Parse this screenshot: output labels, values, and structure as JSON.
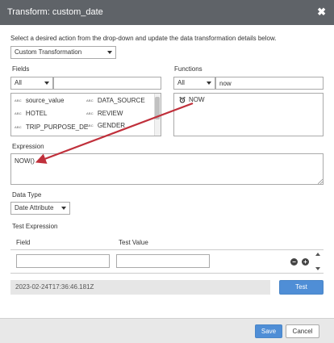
{
  "dialog": {
    "title": "Transform: custom_date",
    "close_glyph": "✖"
  },
  "instruction": "Select a desired action from the drop-down and update the data transformation details below.",
  "action_select": {
    "value": "Custom Transformation"
  },
  "fields": {
    "label": "Fields",
    "filter_value": "All",
    "search_value": "",
    "type_badge": "ABC",
    "items": [
      "source_value",
      "DATA_SOURCE",
      "HOTEL",
      "REVIEW",
      "TRIP_PURPOSE_DE",
      "GENDER"
    ]
  },
  "functions": {
    "label": "Functions",
    "filter_value": "All",
    "search_value": "now",
    "items": [
      "NOW"
    ]
  },
  "expression": {
    "label": "Expression",
    "value": "NOW()"
  },
  "data_type": {
    "label": "Data Type",
    "value": "Date Attribute"
  },
  "test_expression": {
    "label": "Test Expression",
    "field_header": "Field",
    "value_header": "Test Value",
    "field_value": "",
    "test_value": "",
    "remove_glyph": "−",
    "add_glyph": "+"
  },
  "test_result": "2023-02-24T17:36:46.181Z",
  "buttons": {
    "test": "Test",
    "save": "Save",
    "cancel": "Cancel"
  },
  "colors": {
    "titlebar": "#5f6368",
    "primary_button": "#4f8ed6",
    "annotation_arrow": "#c0303b"
  },
  "icons": {
    "function_item": "clock-icon",
    "close": "close-icon"
  }
}
